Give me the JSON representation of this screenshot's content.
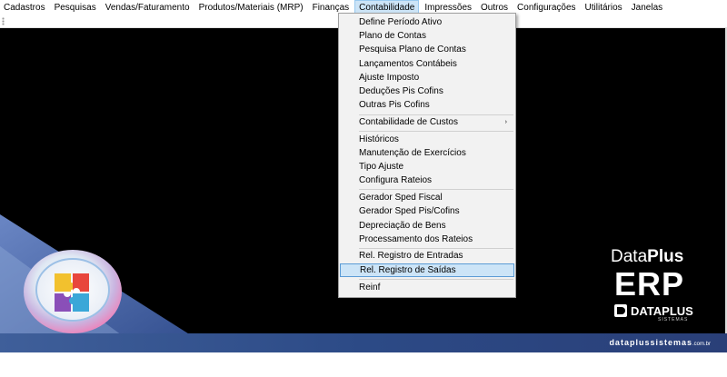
{
  "menubar": {
    "items": [
      "Cadastros",
      "Pesquisas",
      "Vendas/Faturamento",
      "Produtos/Materiais (MRP)",
      "Finanças",
      "Contabilidade",
      "Impressões",
      "Outros",
      "Configurações",
      "Utilitários",
      "Janelas"
    ],
    "active": "Contabilidade"
  },
  "dropdown": {
    "items": [
      "Define Período Ativo",
      "Plano de Contas",
      "Pesquisa Plano de Contas",
      "Lançamentos Contábeis",
      "Ajuste Imposto",
      "Deduções Pis Cofins",
      "Outras Pis Cofins",
      "Contabilidade de Custos",
      "Históricos",
      "Manutenção de Exercícios",
      "Tipo Ajuste",
      "Configura Rateios",
      "Gerador Sped Fiscal",
      "Gerador Sped Pis/Cofins",
      "Depreciação de Bens",
      "Processamento dos Rateios",
      "Rel. Registro de Entradas",
      "Rel. Registro de Saídas",
      "Reinf"
    ],
    "highlighted": "Rel. Registro de Saídas",
    "submenu_arrow": "›"
  },
  "brand": {
    "line1_regular": "Data",
    "line1_bold": "Plus",
    "line2": "ERP",
    "company": "DATAPLUS",
    "tagline": "SISTEMAS",
    "website_main": "dataplussistemas",
    "website_suffix": ".com.br"
  },
  "colors": {
    "menu_highlight": "#cce4f7",
    "menu_highlight_border": "#5b9bd5",
    "canvas_bg": "#000000",
    "footer_bar": "#2c4a86"
  }
}
